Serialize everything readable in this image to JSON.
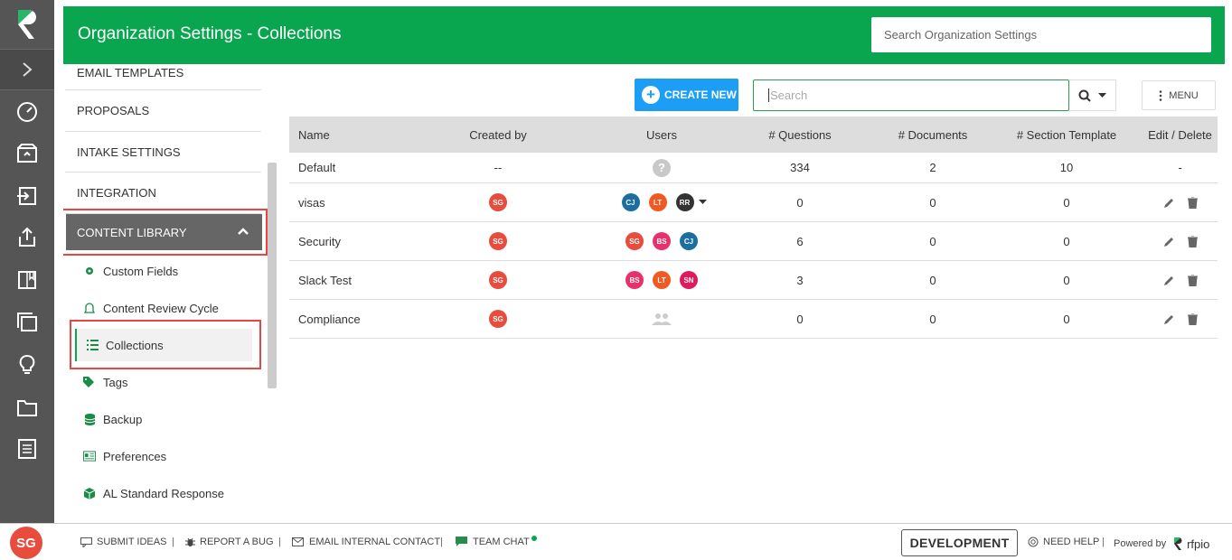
{
  "header": {
    "title": "Organization Settings - Collections",
    "search_placeholder": "Search Organization Settings"
  },
  "rail": {
    "icons": [
      "logo-icon",
      "expand-icon",
      "dashboard-icon",
      "inbox-icon",
      "import-icon",
      "export-icon",
      "book-icon",
      "copy-icon",
      "lightbulb-icon",
      "folder-icon",
      "document-list-icon"
    ],
    "user_initials": "SG"
  },
  "sidenav": {
    "groups": [
      "EMAIL TEMPLATES",
      "PROPOSALS",
      "INTAKE SETTINGS",
      "INTEGRATION"
    ],
    "content_library": "CONTENT LIBRARY",
    "items": [
      "Custom Fields",
      "Content Review Cycle",
      "Collections",
      "Tags",
      "Backup",
      "Preferences",
      "AL Standard Response"
    ]
  },
  "toolbar": {
    "create_new": "CREATE NEW",
    "search_placeholder": "Search",
    "menu": "MENU"
  },
  "table": {
    "headers": [
      "Name",
      "Created by",
      "Users",
      "# Questions",
      "# Documents",
      "# Section Template",
      "Edit / Delete"
    ],
    "rows": [
      {
        "name": "Default",
        "created_by": "--",
        "questions": "334",
        "documents": "2",
        "section_templates": "10",
        "edit": "-"
      },
      {
        "name": "visas",
        "created_by": "SG",
        "users": [
          "CJ",
          "LT",
          "RR"
        ],
        "questions": "0",
        "documents": "0",
        "section_templates": "0"
      },
      {
        "name": "Security",
        "created_by": "SG",
        "users": [
          "SG",
          "BS",
          "CJ"
        ],
        "questions": "6",
        "documents": "0",
        "section_templates": "0"
      },
      {
        "name": "Slack Test",
        "created_by": "SG",
        "users": [
          "BS",
          "LT",
          "SN"
        ],
        "questions": "3",
        "documents": "0",
        "section_templates": "0"
      },
      {
        "name": "Compliance",
        "created_by": "SG",
        "questions": "0",
        "documents": "0",
        "section_templates": "0"
      }
    ]
  },
  "colors": {
    "brand_green": "#0aa64f",
    "accent_blue": "#1c9ef5",
    "avatar_SG": "#e74c3c",
    "avatar_CJ": "#1a6ea0",
    "avatar_LT": "#f05a22",
    "avatar_RR": "#333333",
    "avatar_BS": "#e8306b",
    "avatar_SN": "#e0195a"
  },
  "footer": {
    "submit_ideas": "SUBMIT IDEAS",
    "report_bug": "REPORT A BUG",
    "email_contact": "EMAIL INTERNAL CONTACT",
    "team_chat": "TEAM CHAT",
    "environment": "DEVELOPMENT",
    "need_help": "NEED HELP",
    "powered_by": "Powered by",
    "brand": "rfpio"
  }
}
